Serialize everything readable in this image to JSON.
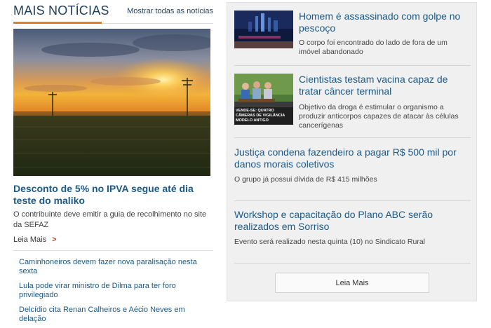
{
  "section": {
    "title": "MAIS NOTÍCIAS",
    "show_all": "Mostrar todas as notícias",
    "accent": "#e67e22"
  },
  "lead": {
    "title": "Desconto de 5% no IPVA segue até dia teste do maliko",
    "summary": "O contribuinte deve emitir a guia de recolhimento no site da SEFAZ",
    "read_more": "Leia Mais",
    "read_more_icon": "chevron-right-icon"
  },
  "links": [
    "Caminhoneiros devem fazer nova paralisação nesta sexta",
    "Lula pode virar ministro de Dilma para ter foro privilegiado",
    "Delcídio cita Renan Calheiros e Aécio Neves em delação"
  ],
  "stories": [
    {
      "title": "Homem é assassinado com golpe no pescoço",
      "summary": "O corpo foi encontrado do lado de fora de um imóvel abandonado"
    },
    {
      "title": "Cientistas testam vacina capaz de tratar câncer terminal",
      "summary": "Objetivo da droga é estimular o organismo a produzir anticorpos capazes de atacar às células cancerígenas",
      "thumb_caption": "VENDE-SE: QUATRO CÂMERAS DE VIGILÂNCIA MODELO ANTIGO"
    },
    {
      "title": "Justiça condena fazendeiro a pagar R$ 500 mil por danos morais coletivos",
      "summary": "O grupo já possui dívida de R$ 415 milhões"
    },
    {
      "title": "Workshop e capacitação do Plano ABC serão realizados em Sorriso",
      "summary": "Evento será realizado nesta quinta (10) no Sindicato Rural"
    }
  ],
  "panel": {
    "button": "Leia Mais"
  },
  "colors": {
    "headline": "#1a5a8a",
    "section_title": "#1f3d5c",
    "panel_bg": "#f0f0f0"
  }
}
